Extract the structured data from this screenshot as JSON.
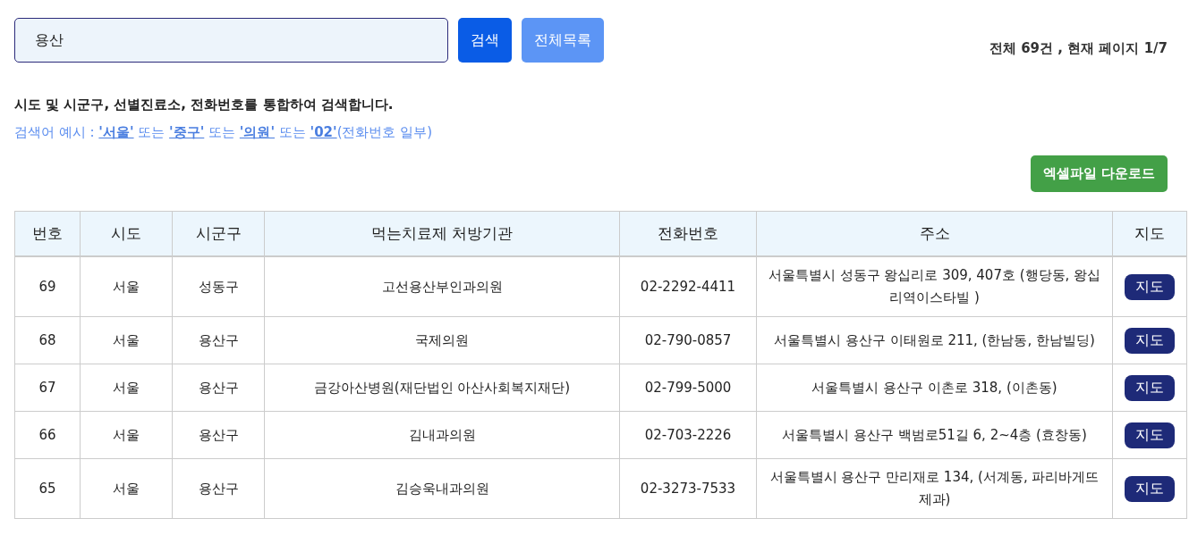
{
  "search": {
    "value": "용산",
    "buttons": [
      {
        "label": "검색",
        "kind": "primary"
      },
      {
        "label": "전체목록",
        "kind": "secondary"
      }
    ]
  },
  "summary": "전체 69건 ,  현재 페이지 1/7",
  "description": "시도 및 시군구, 선별진료소, 전화번호를 통합하여 검색합니다.",
  "example": [
    {
      "kind": "text",
      "text": "검색어 예시 : "
    },
    {
      "kind": "link",
      "text": "'서울'"
    },
    {
      "kind": "text",
      "text": " 또는 "
    },
    {
      "kind": "link",
      "text": "'중구'"
    },
    {
      "kind": "text",
      "text": " 또는 "
    },
    {
      "kind": "link",
      "text": "'의원'"
    },
    {
      "kind": "text",
      "text": " 또는 "
    },
    {
      "kind": "link",
      "text": "'02'"
    },
    {
      "kind": "text",
      "text": "(전화번호 일부)"
    }
  ],
  "download_button": "엑셀파일 다운로드",
  "table": {
    "columns": [
      "번호",
      "시도",
      "시군구",
      "먹는치료제 처방기관",
      "전화번호",
      "주소",
      "지도"
    ],
    "rows": [
      {
        "number": "69",
        "province": "서울",
        "district": "성동구",
        "institution": "고선용산부인과의원",
        "phone": "02-2292-4411",
        "address": "서울특별시 성동구 왕십리로 309, 407호 (행당동, 왕십리역이스타빌 )",
        "map": "지도"
      },
      {
        "number": "68",
        "province": "서울",
        "district": "용산구",
        "institution": "국제의원",
        "phone": "02-790-0857",
        "address": "서울특별시 용산구 이태원로 211, (한남동, 한남빌딩)",
        "map": "지도"
      },
      {
        "number": "67",
        "province": "서울",
        "district": "용산구",
        "institution": "금강아산병원(재단법인 아산사회복지재단)",
        "phone": "02-799-5000",
        "address": "서울특별시 용산구 이촌로 318, (이촌동)",
        "map": "지도"
      },
      {
        "number": "66",
        "province": "서울",
        "district": "용산구",
        "institution": "김내과의원",
        "phone": "02-703-2226",
        "address": "서울특별시 용산구 백범로51길 6, 2~4층 (효창동)",
        "map": "지도"
      },
      {
        "number": "65",
        "province": "서울",
        "district": "용산구",
        "institution": "김승욱내과의원",
        "phone": "02-3273-7533",
        "address": "서울특별시 용산구 만리재로 134, (서계동, 파리바게뜨 제과)",
        "map": "지도"
      }
    ]
  }
}
